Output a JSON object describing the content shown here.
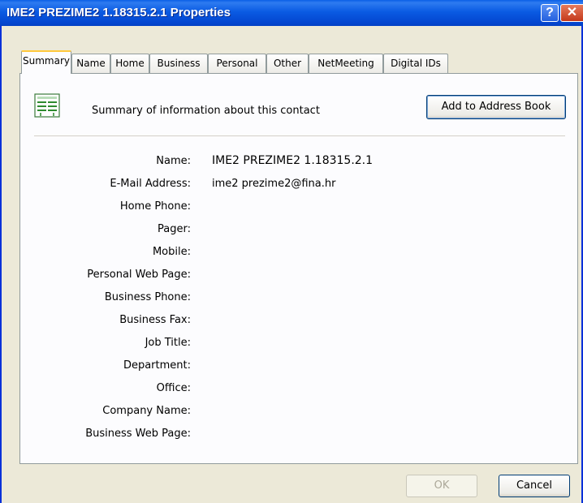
{
  "window": {
    "title": "IME2 PREZIME2 1.18315.2.1 Properties",
    "help_label": "?",
    "close_label": "✕"
  },
  "tabs": [
    {
      "label": "Summary"
    },
    {
      "label": "Name"
    },
    {
      "label": "Home"
    },
    {
      "label": "Business"
    },
    {
      "label": "Personal"
    },
    {
      "label": "Other"
    },
    {
      "label": "NetMeeting"
    },
    {
      "label": "Digital IDs"
    }
  ],
  "summary": {
    "description": "Summary of information about this contact",
    "add_button": "Add to Address Book",
    "icon": "contact-card-icon"
  },
  "fields": [
    {
      "label": "Name:",
      "value": "IME2 PREZIME2  1.18315.2.1"
    },
    {
      "label": "E-Mail Address:",
      "value": "ime2 prezime2@fina.hr"
    },
    {
      "label": "Home Phone:",
      "value": ""
    },
    {
      "label": "Pager:",
      "value": ""
    },
    {
      "label": "Mobile:",
      "value": ""
    },
    {
      "label": "Personal Web Page:",
      "value": ""
    },
    {
      "label": "Business Phone:",
      "value": ""
    },
    {
      "label": "Business Fax:",
      "value": ""
    },
    {
      "label": "Job Title:",
      "value": ""
    },
    {
      "label": "Department:",
      "value": ""
    },
    {
      "label": "Office:",
      "value": ""
    },
    {
      "label": "Company Name:",
      "value": ""
    },
    {
      "label": "Business Web Page:",
      "value": ""
    }
  ],
  "footer": {
    "ok_label": "OK",
    "cancel_label": "Cancel"
  }
}
